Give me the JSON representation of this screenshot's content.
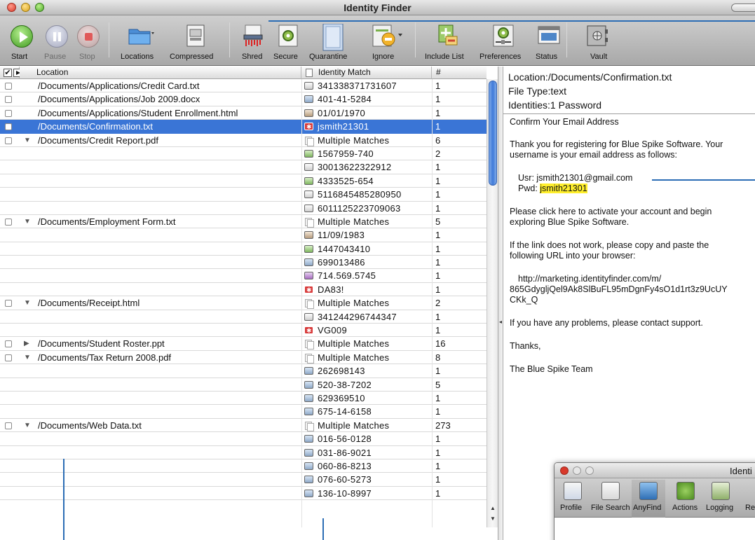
{
  "window": {
    "title": "Identity Finder"
  },
  "toolbar": {
    "start": "Start",
    "pause": "Pause",
    "stop": "Stop",
    "locations": "Locations",
    "compressed": "Compressed",
    "shred": "Shred",
    "secure": "Secure",
    "quarantine": "Quarantine",
    "ignore": "Ignore",
    "include_list": "Include List",
    "preferences": "Preferences",
    "status": "Status",
    "vault": "Vault"
  },
  "table": {
    "headers": {
      "location": "Location",
      "identity_match": "Identity Match",
      "count": "#"
    },
    "rows": [
      {
        "expander": "",
        "location": "/Documents/Applications/Credit Card.txt",
        "icon": "card",
        "identity": "341338371731607",
        "count": "1"
      },
      {
        "expander": "",
        "location": "/Documents/Applications/Job 2009.docx",
        "icon": "ssn",
        "identity": "401-41-5284",
        "count": "1"
      },
      {
        "expander": "",
        "location": "/Documents/Applications/Student Enrollment.html",
        "icon": "date",
        "identity": "01/01/1970",
        "count": "1"
      },
      {
        "expander": "",
        "location": "/Documents/Confirmation.txt",
        "icon": "pwd",
        "identity": "jsmith21301",
        "count": "1",
        "selected": true
      },
      {
        "expander": "▼",
        "location": "/Documents/Credit Report.pdf",
        "icon": "multi",
        "identity": "Multiple Matches",
        "count": "6"
      },
      {
        "expander": "",
        "location": "",
        "icon": "bank",
        "identity": "1567959-740",
        "count": "2"
      },
      {
        "expander": "",
        "location": "",
        "icon": "card",
        "identity": "30013622322912",
        "count": "1"
      },
      {
        "expander": "",
        "location": "",
        "icon": "bank",
        "identity": "4333525-654",
        "count": "1"
      },
      {
        "expander": "",
        "location": "",
        "icon": "card",
        "identity": "5116845485280950",
        "count": "1"
      },
      {
        "expander": "",
        "location": "",
        "icon": "card",
        "identity": "6011125223709063",
        "count": "1"
      },
      {
        "expander": "▼",
        "location": "/Documents/Employment Form.txt",
        "icon": "multi",
        "identity": "Multiple Matches",
        "count": "5"
      },
      {
        "expander": "",
        "location": "",
        "icon": "date",
        "identity": "11/09/1983",
        "count": "1"
      },
      {
        "expander": "",
        "location": "",
        "icon": "bank",
        "identity": "1447043410",
        "count": "1"
      },
      {
        "expander": "",
        "location": "",
        "icon": "ssn",
        "identity": "699013486",
        "count": "1"
      },
      {
        "expander": "",
        "location": "",
        "icon": "phone",
        "identity": "714.569.5745",
        "count": "1"
      },
      {
        "expander": "",
        "location": "",
        "icon": "pwd",
        "identity": "DA83!",
        "count": "1"
      },
      {
        "expander": "▼",
        "location": "/Documents/Receipt.html",
        "icon": "multi",
        "identity": "Multiple Matches",
        "count": "2"
      },
      {
        "expander": "",
        "location": "",
        "icon": "card",
        "identity": "341244296744347",
        "count": "1"
      },
      {
        "expander": "",
        "location": "",
        "icon": "pwd",
        "identity": "VG009",
        "count": "1"
      },
      {
        "expander": "▶",
        "location": "/Documents/Student Roster.ppt",
        "icon": "multi",
        "identity": "Multiple Matches",
        "count": "16"
      },
      {
        "expander": "▼",
        "location": "/Documents/Tax Return 2008.pdf",
        "icon": "multi",
        "identity": "Multiple Matches",
        "count": "8"
      },
      {
        "expander": "",
        "location": "",
        "icon": "ssn",
        "identity": "262698143",
        "count": "1"
      },
      {
        "expander": "",
        "location": "",
        "icon": "ssn",
        "identity": "520-38-7202",
        "count": "5"
      },
      {
        "expander": "",
        "location": "",
        "icon": "ssn",
        "identity": "629369510",
        "count": "1"
      },
      {
        "expander": "",
        "location": "",
        "icon": "ssn",
        "identity": "675-14-6158",
        "count": "1"
      },
      {
        "expander": "▼",
        "location": "/Documents/Web Data.txt",
        "icon": "multi",
        "identity": "Multiple Matches",
        "count": "273"
      },
      {
        "expander": "",
        "location": "",
        "icon": "ssn",
        "identity": "016-56-0128",
        "count": "1"
      },
      {
        "expander": "",
        "location": "",
        "icon": "ssn",
        "identity": "031-86-9021",
        "count": "1"
      },
      {
        "expander": "",
        "location": "",
        "icon": "ssn",
        "identity": "060-86-8213",
        "count": "1"
      },
      {
        "expander": "",
        "location": "",
        "icon": "ssn",
        "identity": "076-60-5273",
        "count": "1"
      },
      {
        "expander": "",
        "location": "",
        "icon": "ssn",
        "identity": "136-10-8997",
        "count": "1"
      }
    ]
  },
  "info": {
    "location": "Location:/Documents/Confirmation.txt",
    "file_type": "File Type:text",
    "identities": "Identities:1 Password"
  },
  "preview": {
    "line1": "Confirm Your Email Address",
    "line2": "Thank you for registering for Blue Spike Software. Your",
    "line3": "username is your email address as follows:",
    "usr": "Usr: jsmith21301@gmail.com",
    "pwd_label": "Pwd: ",
    "pwd_value": "jsmith21301",
    "line4": "Please click here to activate your account and begin",
    "line5": "exploring Blue Spike Software.",
    "line6": "If the link does not work, please copy and paste the",
    "line7": "following URL into your browser:",
    "url1": "http://marketing.identityfinder.com/m/",
    "url2": "865GdygljQel9Ak8SlBuFL95mDgnFy4sO1d1rt3z9UcUY",
    "url3": "CKk_Q",
    "line8": "If you have any problems, please contact support.",
    "line9": "Thanks,",
    "line10": "The Blue Spike Team"
  },
  "second_window": {
    "title": "Identi",
    "toolbar": [
      "Profile",
      "File Search",
      "AnyFind",
      "Actions",
      "Logging",
      "Re"
    ]
  },
  "colors": {
    "selection": "#3a75d6",
    "highlight": "#ffef2c",
    "callout": "#2c6db5"
  }
}
